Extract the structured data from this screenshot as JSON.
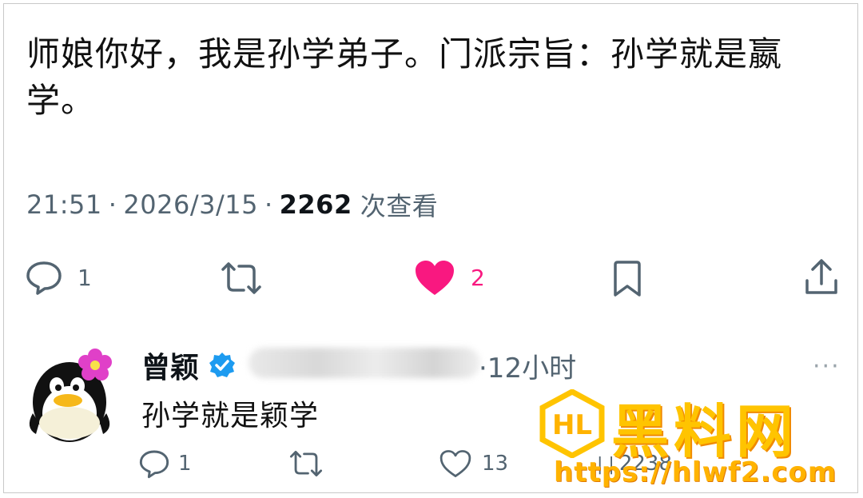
{
  "tweet": {
    "line1": "师娘你好，我是孙学弟子。门派宗旨：孙学就是嬴",
    "line2": "学。",
    "time": "21:51",
    "date": "2026/3/15",
    "views": "2262",
    "views_label": "次查看",
    "separator": "·"
  },
  "actions": {
    "reply_count": "1",
    "like_count": "2",
    "like_color": "#f91880"
  },
  "reply": {
    "name": "曾颖",
    "time": "·12小时",
    "text": "孙学就是颖学",
    "more": "···",
    "reply_count": "1",
    "like_count": "13",
    "views_partial": "2238"
  },
  "watermark": {
    "title": "黑料网",
    "url": "https://hlwf2.com",
    "logo_letters": "HL"
  },
  "icons": {
    "reply": "reply-icon",
    "retweet": "retweet-icon",
    "like": "heart-icon",
    "bookmark": "bookmark-icon",
    "share": "share-icon",
    "verified": "verified-badge-icon",
    "views": "views-icon"
  }
}
